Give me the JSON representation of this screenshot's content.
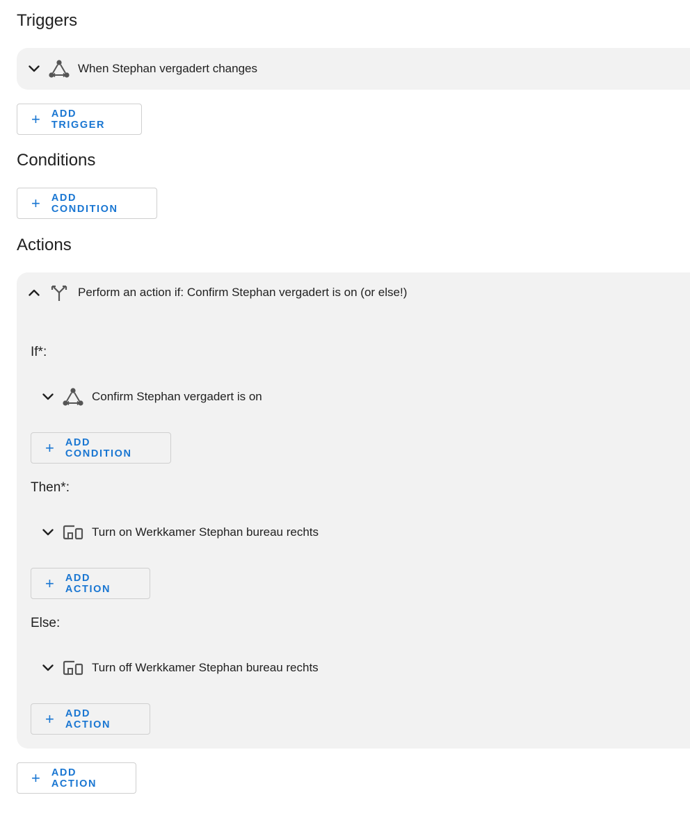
{
  "triggers": {
    "heading": "Triggers",
    "items": [
      {
        "icon": "entity-state-icon",
        "label": "When Stephan vergadert changes"
      }
    ],
    "add_label": "Add trigger"
  },
  "conditions": {
    "heading": "Conditions",
    "add_label": "Add condition"
  },
  "actions": {
    "heading": "Actions",
    "choose_block": {
      "icon": "branch-icon",
      "label": "Perform an action if: Confirm Stephan vergadert is on (or else!)",
      "if_label": "If*:",
      "if_item": {
        "icon": "entity-state-icon",
        "label": "Confirm Stephan vergadert is on"
      },
      "if_add_label": "Add condition",
      "then_label": "Then*:",
      "then_item": {
        "icon": "devices-icon",
        "label": "Turn on Werkkamer Stephan bureau rechts"
      },
      "then_add_label": "Add action",
      "else_label": "Else:",
      "else_item": {
        "icon": "devices-icon",
        "label": "Turn off Werkkamer Stephan bureau rechts"
      },
      "else_add_label": "Add action"
    },
    "add_label": "Add action"
  },
  "colors": {
    "accent": "#1976d2",
    "card_bg": "#f2f2f2",
    "text": "#212121",
    "icon": "#555555"
  }
}
